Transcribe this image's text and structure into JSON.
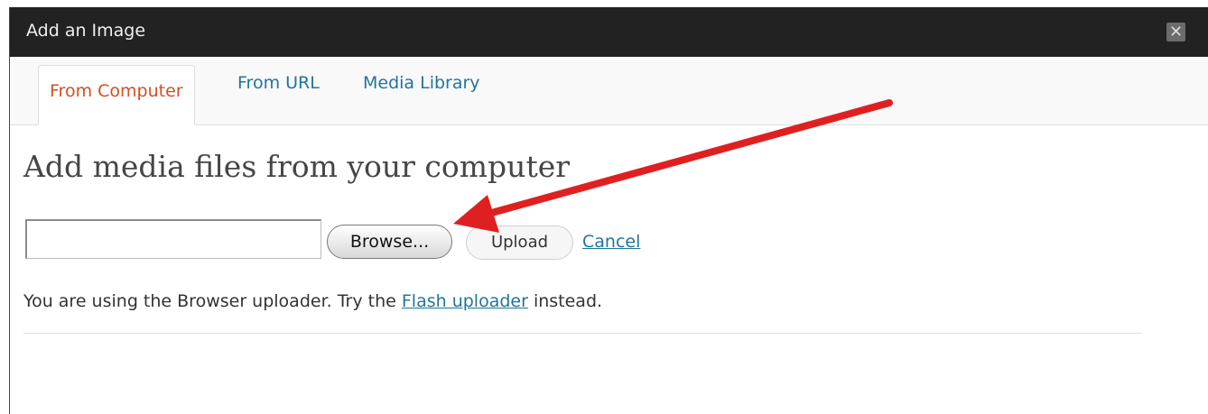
{
  "dialog": {
    "title": "Add an Image",
    "close_icon": "close-icon",
    "close_glyph": "✕"
  },
  "tabs": [
    {
      "label": "From Computer",
      "active": true
    },
    {
      "label": "From URL",
      "active": false
    },
    {
      "label": "Media Library",
      "active": false
    }
  ],
  "main": {
    "heading": "Add media files from your computer",
    "file_input_value": "",
    "browse_label": "Browse...",
    "upload_label": "Upload",
    "cancel_label": "Cancel",
    "note_prefix": "You are using the Browser uploader. Try the ",
    "note_link": "Flash uploader",
    "note_suffix": " instead."
  },
  "colors": {
    "titlebar": "#222222",
    "link": "#21759b",
    "active_tab": "#d54e21",
    "annotation_arrow": "#e02020"
  }
}
